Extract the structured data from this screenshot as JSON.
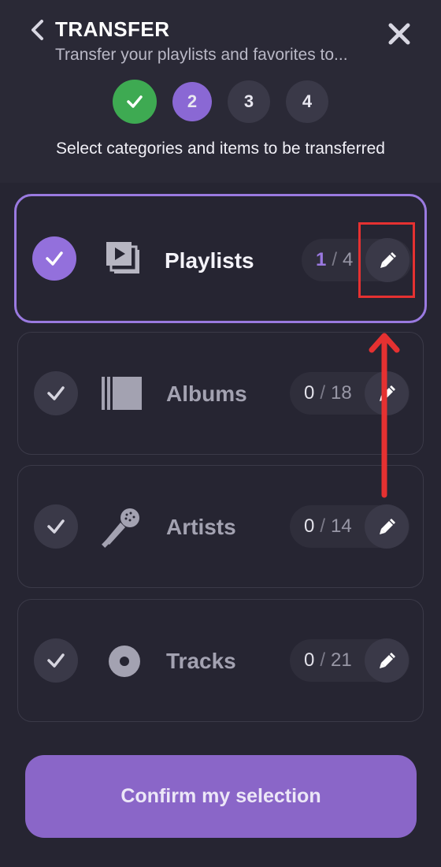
{
  "header": {
    "title": "TRANSFER",
    "subtitle": "Transfer your playlists and favorites to...",
    "instruction": "Select categories and items to be transferred"
  },
  "steps": [
    {
      "label": "",
      "state": "done"
    },
    {
      "label": "2",
      "state": "active"
    },
    {
      "label": "3",
      "state": "pending"
    },
    {
      "label": "4",
      "state": "pending"
    }
  ],
  "categories": [
    {
      "label": "Playlists",
      "selected_count": "1",
      "separator": "/",
      "total": "4",
      "checked": true,
      "icon": "playlists-icon"
    },
    {
      "label": "Albums",
      "selected_count": "0",
      "separator": "/",
      "total": "18",
      "checked": false,
      "icon": "albums-icon"
    },
    {
      "label": "Artists",
      "selected_count": "0",
      "separator": "/",
      "total": "14",
      "checked": false,
      "icon": "microphone-icon"
    },
    {
      "label": "Tracks",
      "selected_count": "0",
      "separator": "/",
      "total": "21",
      "checked": false,
      "icon": "disc-icon"
    }
  ],
  "confirm_label": "Confirm my selection",
  "colors": {
    "background": "#262532",
    "accent": "#8a68d4",
    "success": "#3eaa52",
    "annotation": "#e53131"
  }
}
